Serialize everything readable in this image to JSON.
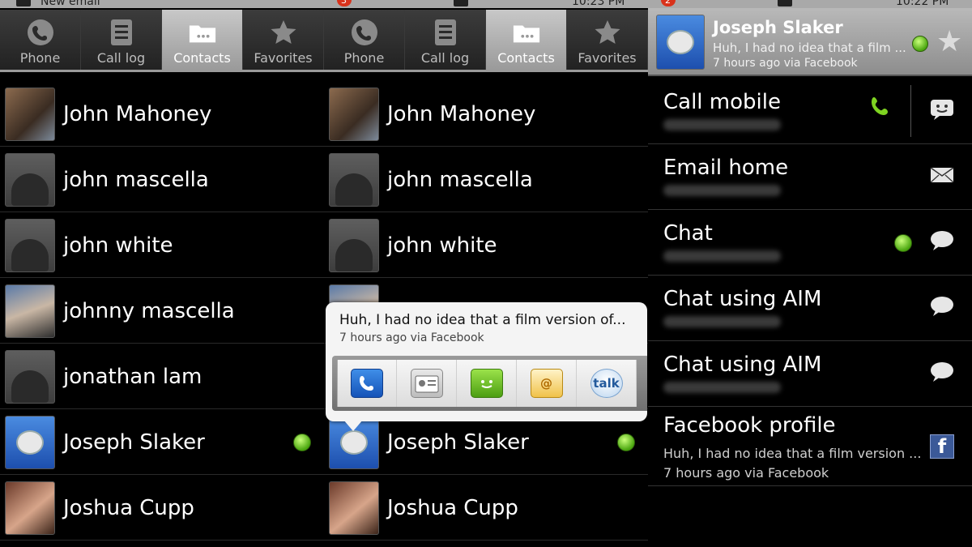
{
  "status": {
    "left_text": "New email",
    "p1_badge": "3",
    "p1_time": "10:23 PM",
    "p3_badge": "2",
    "p3_time": "10:22 PM"
  },
  "tabs": [
    {
      "label": "Phone",
      "icon": "phone-icon"
    },
    {
      "label": "Call log",
      "icon": "call-log-icon"
    },
    {
      "label": "Contacts",
      "icon": "contacts-icon",
      "selected": true
    },
    {
      "label": "Favorites",
      "icon": "star-icon"
    }
  ],
  "contacts": [
    {
      "name": "John Mahoney",
      "avatar": "photo"
    },
    {
      "name": "john mascella",
      "avatar": "droid"
    },
    {
      "name": "john white",
      "avatar": "droid"
    },
    {
      "name": "johnny mascella",
      "avatar": "photo"
    },
    {
      "name": "jonathan lam",
      "avatar": "droid"
    },
    {
      "name": "Joseph Slaker",
      "avatar": "robot",
      "online": true
    },
    {
      "name": "Joshua Cupp",
      "avatar": "photo"
    }
  ],
  "popup": {
    "status_text": "Huh, I had no idea that a film version of...",
    "status_sub": "7 hours ago via Facebook",
    "actions": [
      {
        "name": "call-action",
        "icon": "phone-icon"
      },
      {
        "name": "contact-card-action",
        "icon": "contact-card-icon"
      },
      {
        "name": "sms-action",
        "icon": "sms-icon"
      },
      {
        "name": "email-action",
        "icon": "email-icon"
      },
      {
        "name": "talk-action",
        "icon": "talk-icon",
        "label": "talk"
      }
    ]
  },
  "detail": {
    "name": "Joseph Slaker",
    "status_text": "Huh, I had no idea that a film ...",
    "status_sub": "7 hours ago via Facebook",
    "rows": [
      {
        "label": "Call mobile",
        "icon": "sms-icon"
      },
      {
        "label": "Email home",
        "icon": "email-icon"
      },
      {
        "label": "Chat",
        "icon": "chat-icon"
      },
      {
        "label": "Chat using AIM",
        "icon": "chat-icon"
      },
      {
        "label": "Chat using AIM",
        "icon": "chat-icon"
      }
    ],
    "facebook": {
      "label": "Facebook profile",
      "line1": "Huh, I had no idea that a film version ...",
      "line2": "7 hours ago via Facebook",
      "icon_letter": "f"
    }
  },
  "colors": {
    "online_dot": "#4aa60f",
    "call_green": "#7ed321",
    "facebook_blue": "#3b5998"
  }
}
